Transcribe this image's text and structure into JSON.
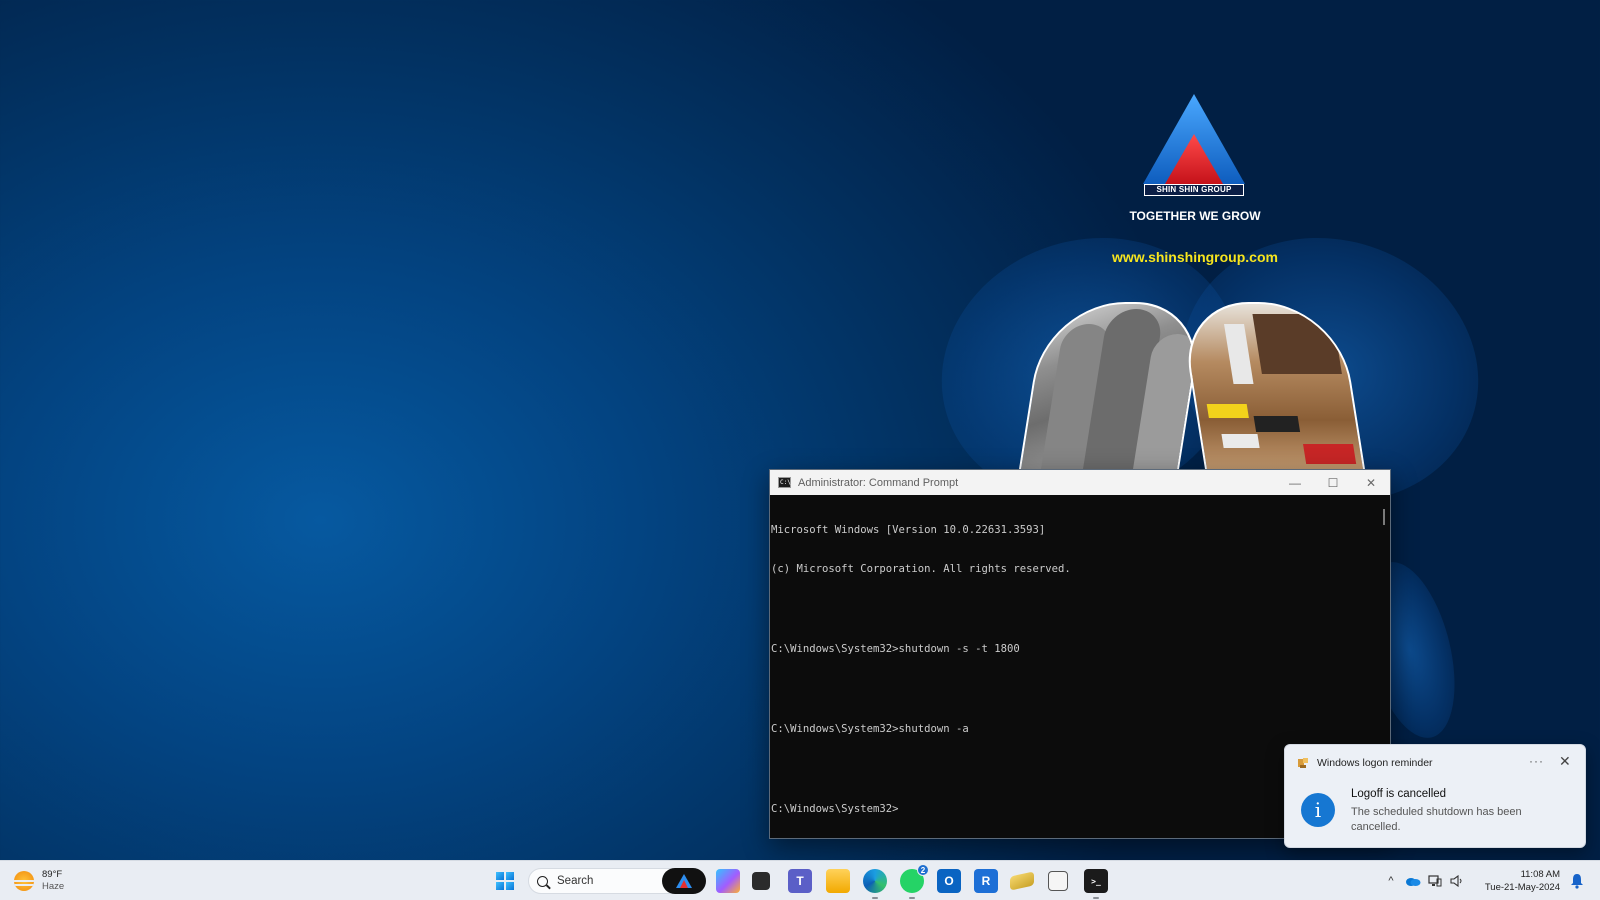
{
  "wallpaper": {
    "brand": "SHIN SHIN GROUP",
    "tagline": "TOGETHER WE GROW",
    "website": "www.shinshingroup.com"
  },
  "cmd_window": {
    "title": "Administrator: Command Prompt",
    "icon_label": "C:\\",
    "lines": [
      "Microsoft Windows [Version 10.0.22631.3593]",
      "(c) Microsoft Corporation. All rights reserved.",
      "",
      "C:\\Windows\\System32>shutdown -s -t 1800",
      "",
      "C:\\Windows\\System32>shutdown -a",
      "",
      "C:\\Windows\\System32>"
    ],
    "minimize_glyph": "—",
    "maximize_glyph": "☐",
    "close_glyph": "✕"
  },
  "toast": {
    "app_name": "Windows logon reminder",
    "more_glyph": "···",
    "close_glyph": "✕",
    "info_glyph": "i",
    "title": "Logoff is cancelled",
    "message": "The scheduled shutdown has been cancelled."
  },
  "taskbar": {
    "weather": {
      "temp": "89°F",
      "condition": "Haze"
    },
    "search_placeholder": "Search",
    "apps": [
      {
        "name": "copilot-app",
        "label": ""
      },
      {
        "name": "file-manager-app",
        "label": ""
      },
      {
        "name": "teams-app",
        "label": "T"
      },
      {
        "name": "file-explorer-app",
        "label": ""
      },
      {
        "name": "edge-app",
        "label": ""
      },
      {
        "name": "whatsapp-app",
        "label": "",
        "badge": "2"
      },
      {
        "name": "outlook-app",
        "label": "O"
      },
      {
        "name": "remote-app",
        "label": "R"
      },
      {
        "name": "notes-app",
        "label": ""
      },
      {
        "name": "task-view-app",
        "label": ""
      },
      {
        "name": "terminal-app",
        "label": ">_"
      }
    ],
    "tray": {
      "chevron": "^"
    },
    "clock": {
      "time": "11:08 AM",
      "date": "Tue-21-May-2024"
    }
  },
  "colors": {
    "accent": "#1677d2",
    "website_yellow": "#f7e51e"
  }
}
